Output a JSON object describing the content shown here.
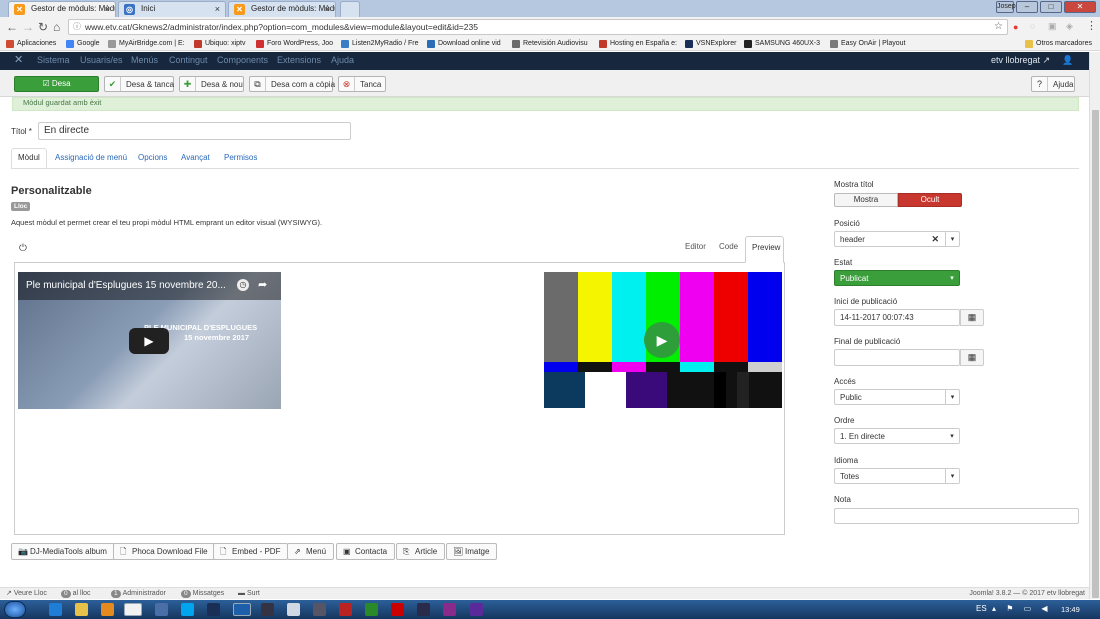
{
  "browser": {
    "tabs": [
      {
        "label": "Gestor de mòduls: Mòdu",
        "icon": "joomla-icon"
      },
      {
        "label": "Inici",
        "icon": "globe-icon"
      },
      {
        "label": "Gestor de mòduls: Mòdu",
        "icon": "joomla-icon"
      }
    ],
    "user": "Josep",
    "url": "www.etv.cat/Gknews2/administrator/index.php?option=com_modules&view=module&layout=edit&id=235",
    "bookmarks": [
      "Aplicaciones",
      "Google",
      "MyAirBridge.com | E:",
      "Ubiquo: xiptv",
      "Foro WordPress, Joo",
      "Listen2MyRadio / Fre",
      "Download online vid",
      "Retevisión Audiovisu",
      "Hosting en España e:",
      "VSNExplorer",
      "SAMSUNG 460UX-3",
      "Easy OnAir | Playout"
    ],
    "other_bookmarks": "Otros marcadores"
  },
  "joomla_nav": {
    "items": [
      "Sistema",
      "Usuaris/es",
      "Menús",
      "Contingut",
      "Components",
      "Extensions",
      "Ajuda"
    ],
    "site": "etv llobregat"
  },
  "toolbar": {
    "save": "Desa",
    "save_close": "Desa & tanca",
    "save_new": "Desa & nou",
    "save_copy": "Desa com a còpia",
    "close": "Tanca",
    "help": "Ajuda"
  },
  "message": "Mòdul guardat amb èxit",
  "form": {
    "title_label": "Títol *",
    "title_value": "En directe",
    "tabs": [
      "Mòdul",
      "Assignació de menú",
      "Opcions",
      "Avançat",
      "Permisos"
    ],
    "module_name": "Personalitzable",
    "module_badge": "Lloc",
    "module_desc": "Aquest mòdul et permet crear el teu propi mòdul HTML emprant un editor visual (WYSIWYG).",
    "editor_tabs": [
      "Editor",
      "Code",
      "Preview"
    ],
    "video1_title": "Ple municipal d'Esplugues 15 novembre 20...",
    "video1_overlay1": "PLE MUNICIPAL D'ESPLUGUES",
    "video1_overlay2": "15 novembre 2017",
    "editor_buttons": [
      "DJ-MediaTools album",
      "Phoca Download File",
      "Embed - PDF",
      "Menú",
      "Contacta",
      "Article",
      "Imatge"
    ]
  },
  "sidebar": {
    "show_title_label": "Mostra títol",
    "show_title_on": "Mostra",
    "show_title_off": "Ocult",
    "position_label": "Posició",
    "position_value": "header",
    "status_label": "Estat",
    "status_value": "Publicat",
    "start_label": "Inici de publicació",
    "start_value": "14-11-2017 00:07:43",
    "end_label": "Final de publicació",
    "end_value": "",
    "access_label": "Accés",
    "access_value": "Public",
    "order_label": "Ordre",
    "order_value": "1. En directe",
    "language_label": "Idioma",
    "language_value": "Totes",
    "note_label": "Nota",
    "note_value": ""
  },
  "statusbar": {
    "view_site": "Veure Lloc",
    "site_count": "0",
    "site_text": "al lloc",
    "admin_count": "1",
    "admin_text": "Administrador",
    "msg_count": "0",
    "msg_text": "Missatges",
    "logout": "Surt",
    "version": "Joomla! 3.8.2 — © 2017 etv llobregat"
  },
  "taskbar": {
    "lang": "ES",
    "time": "13:49"
  },
  "colors": {
    "green": "#3a9e3a",
    "red": "#c8372d",
    "nav": "#17273d",
    "link": "#2a69b8"
  }
}
